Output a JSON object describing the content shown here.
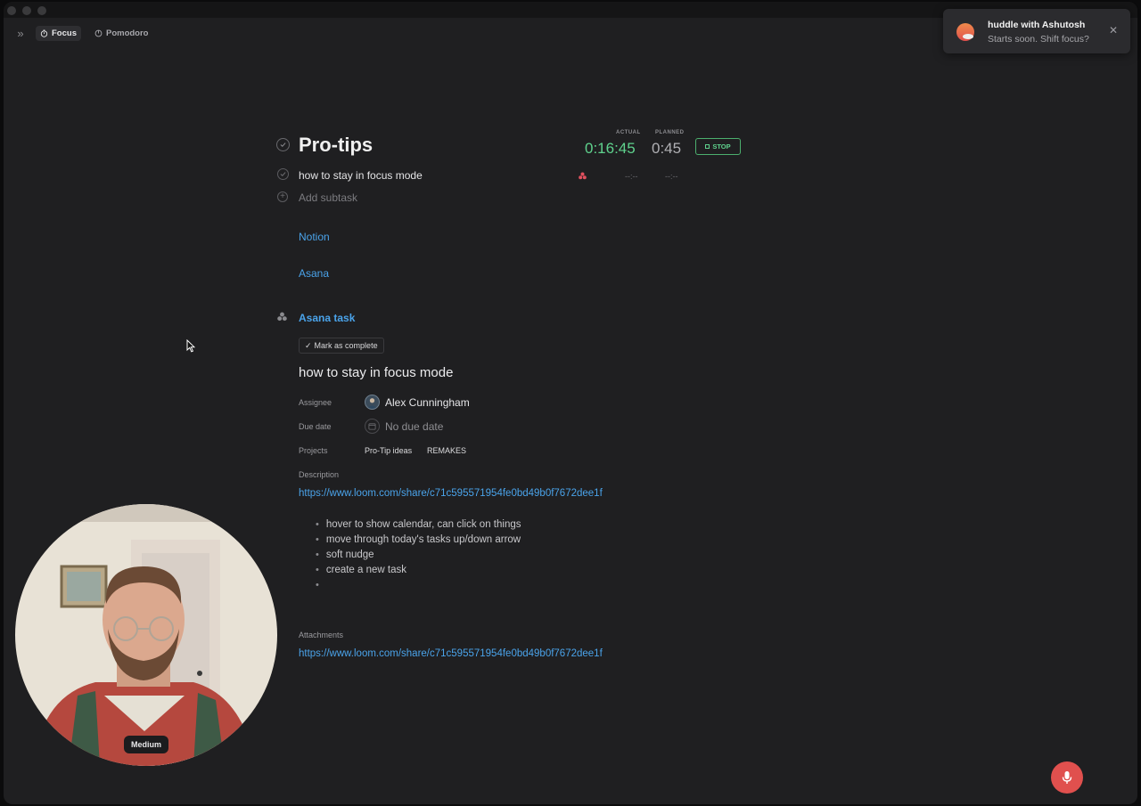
{
  "toolbar": {
    "tabs": [
      {
        "label": "Focus",
        "active": true
      },
      {
        "label": "Pomodoro",
        "active": false
      }
    ]
  },
  "notification": {
    "title": "huddle with Ashutosh",
    "subtitle": "Starts soon. Shift focus?"
  },
  "task": {
    "title": "Pro-tips",
    "actual_label": "ACTUAL",
    "planned_label": "PLANNED",
    "actual_time": "0:16:45",
    "planned_time": "0:45",
    "stop_label": "STOP",
    "subtask": {
      "label": "how to stay in focus mode",
      "actual": "--:--",
      "planned": "--:--"
    },
    "add_subtask_placeholder": "Add subtask",
    "links": [
      "Notion",
      "Asana"
    ]
  },
  "asana": {
    "header": "Asana task",
    "mark_complete": "Mark as complete",
    "title": "how to stay in focus mode",
    "assignee_label": "Assignee",
    "assignee": "Alex Cunningham",
    "due_label": "Due date",
    "due_value": "No due date",
    "projects_label": "Projects",
    "projects": [
      "Pro-Tip ideas",
      "REMAKES"
    ],
    "description_label": "Description",
    "description_url": "https://www.loom.com/share/c71c595571954fe0bd49b0f7672dee1f",
    "bullets": [
      "hover to show calendar, can click on things",
      "move through today's tasks up/down arrow",
      "soft nudge",
      "create a new task",
      ""
    ],
    "attachments_label": "Attachments",
    "attachment_url": "https://www.loom.com/share/c71c595571954fe0bd49b0f7672dee1f"
  },
  "webcam": {
    "size_label": "Medium"
  },
  "colors": {
    "accent_green": "#5fd28d",
    "link_blue": "#4aa3ea",
    "mic_red": "#e0504e",
    "background": "#1f1f21"
  }
}
